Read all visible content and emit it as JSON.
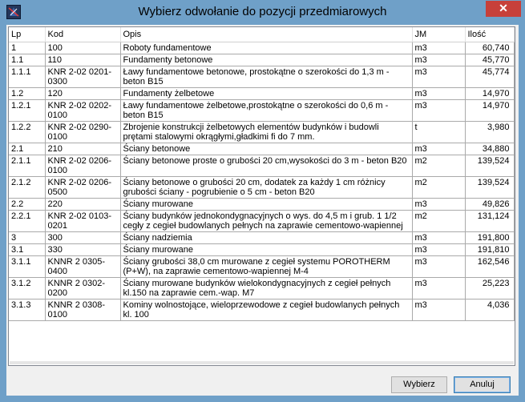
{
  "window": {
    "title": "Wybierz odwołanie do pozycji przedmiarowych",
    "close_glyph": "✕"
  },
  "table": {
    "columns": [
      "Lp",
      "Kod",
      "Opis",
      "JM",
      "Ilość"
    ],
    "rows": [
      {
        "lp": "1",
        "kod": "100",
        "opis": "Roboty fundamentowe",
        "jm": "m3",
        "ilosc": "60,740"
      },
      {
        "lp": "1.1",
        "kod": "110",
        "opis": "Fundamenty betonowe",
        "jm": "m3",
        "ilosc": "45,770"
      },
      {
        "lp": "1.1.1",
        "kod": "KNR 2-02 0201-0300",
        "opis": "Ławy fundamentowe betonowe, prostokątne o szerokości do 1,3 m - beton B15",
        "jm": "m3",
        "ilosc": "45,774"
      },
      {
        "lp": "1.2",
        "kod": "120",
        "opis": "Fundamenty żelbetowe",
        "jm": "m3",
        "ilosc": "14,970"
      },
      {
        "lp": "1.2.1",
        "kod": "KNR 2-02 0202-0100",
        "opis": "Ławy fundamentowe żelbetowe,prostokątne o szerokości do 0,6 m - beton B15",
        "jm": "m3",
        "ilosc": "14,970"
      },
      {
        "lp": "1.2.2",
        "kod": "KNR 2-02 0290-0100",
        "opis": "Zbrojenie konstrukcji żelbetowych elementów budynków i budowli prętami stalowymi okrągłymi,gładkimi fi do 7 mm.",
        "jm": "t",
        "ilosc": "3,980"
      },
      {
        "lp": "2.1",
        "kod": "210",
        "opis": "Ściany betonowe",
        "jm": "m3",
        "ilosc": "34,880"
      },
      {
        "lp": "2.1.1",
        "kod": "KNR 2-02 0206-0100",
        "opis": "Ściany betonowe proste o grubości 20 cm,wysokości do 3 m - beton B20",
        "jm": "m2",
        "ilosc": "139,524"
      },
      {
        "lp": "2.1.2",
        "kod": "KNR 2-02 0206-0500",
        "opis": "Ściany betonowe o grubości 20 cm, dodatek za każdy 1 cm różnicy grubości ściany - pogrubienie o 5 cm - beton B20",
        "jm": "m2",
        "ilosc": "139,524"
      },
      {
        "lp": "2.2",
        "kod": "220",
        "opis": "Ściany murowane",
        "jm": "m3",
        "ilosc": "49,826"
      },
      {
        "lp": "2.2.1",
        "kod": "KNR 2-02 0103-0201",
        "opis": "Ściany budynków jednokondygnacyjnych o wys. do 4,5 m i grub. 1 1/2 cegły z cegieł budowlanych pełnych na zaprawie cementowo-wapiennej",
        "jm": "m2",
        "ilosc": "131,124"
      },
      {
        "lp": "3",
        "kod": "300",
        "opis": "Ściany nadziemia",
        "jm": "m3",
        "ilosc": "191,800"
      },
      {
        "lp": "3.1",
        "kod": "330",
        "opis": "Ściany murowane",
        "jm": "m3",
        "ilosc": "191,810"
      },
      {
        "lp": "3.1.1",
        "kod": "KNNR 2 0305-0400",
        "opis": "Ściany grubości 38,0 cm murowane z cegieł systemu POROTHERM (P+W), na zaprawie cementowo-wapiennej M-4",
        "jm": "m3",
        "ilosc": "162,546"
      },
      {
        "lp": "3.1.2",
        "kod": "KNNR 2 0302-0200",
        "opis": "Ściany murowane budynków wielokondygnacyjnych z cegieł pełnych kl.150 na zaprawie cem.-wap. M7",
        "jm": "m3",
        "ilosc": "25,223"
      },
      {
        "lp": "3.1.3",
        "kod": "KNNR 2 0308-0100",
        "opis": "Kominy wolnostojące, wieloprzewodowe z cegieł budowlanych pełnych kl. 100",
        "jm": "m3",
        "ilosc": "4,036"
      }
    ]
  },
  "buttons": {
    "select_label": "Wybierz",
    "cancel_label": "Anuluj"
  }
}
